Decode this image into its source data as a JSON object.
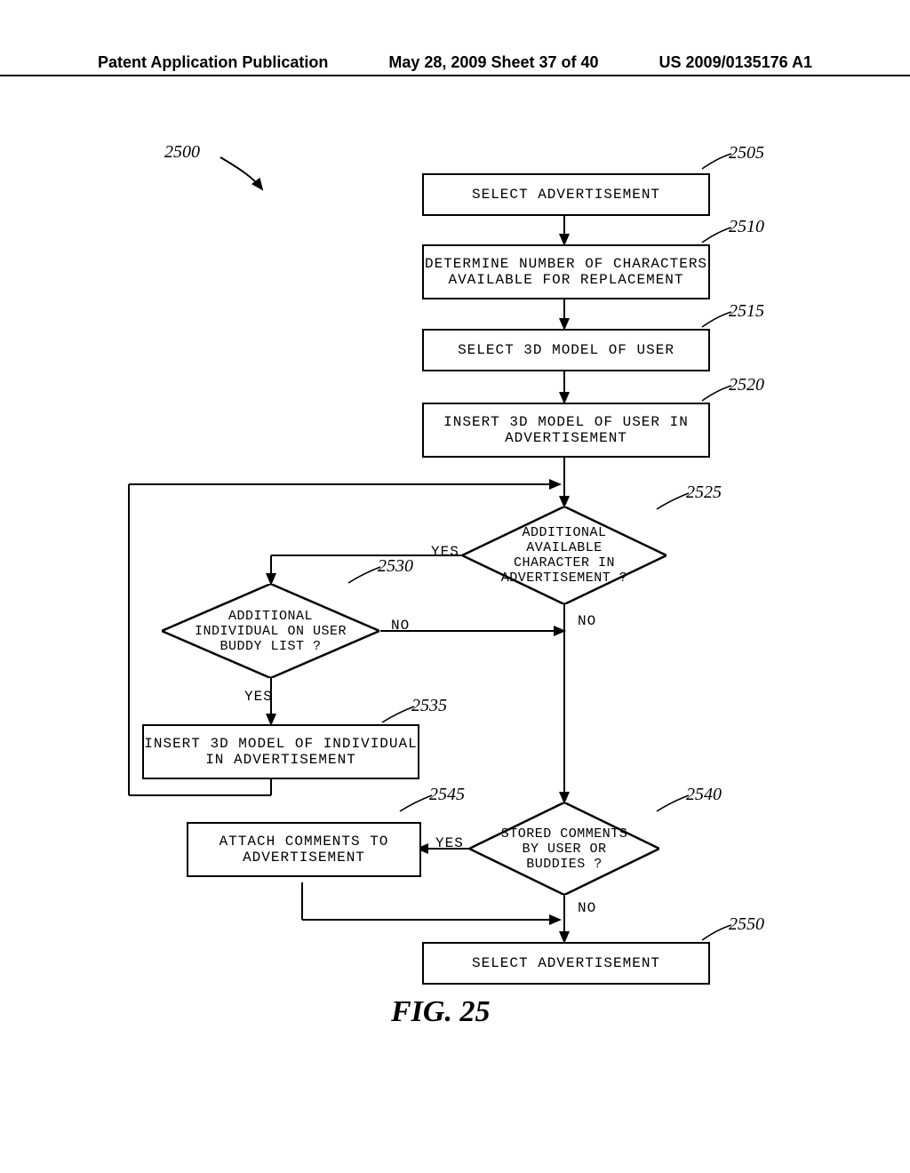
{
  "header": {
    "left": "Patent Application Publication",
    "center": "May 28, 2009  Sheet 37 of 40",
    "right": "US 2009/0135176 A1"
  },
  "refs": {
    "r2500": "2500",
    "r2505": "2505",
    "r2510": "2510",
    "r2515": "2515",
    "r2520": "2520",
    "r2525": "2525",
    "r2530": "2530",
    "r2535": "2535",
    "r2540": "2540",
    "r2545": "2545",
    "r2550": "2550"
  },
  "boxes": {
    "b2505": "SELECT ADVERTISEMENT",
    "b2510": "DETERMINE NUMBER OF CHARACTERS AVAILABLE FOR REPLACEMENT",
    "b2515": "SELECT 3D MODEL OF USER",
    "b2520": "INSERT 3D MODEL OF USER IN ADVERTISEMENT",
    "b2535": "INSERT 3D MODEL OF INDIVIDUAL IN ADVERTISEMENT",
    "b2545": "ATTACH COMMENTS TO ADVERTISEMENT",
    "b2550": "SELECT ADVERTISEMENT"
  },
  "diamonds": {
    "d2525": "ADDITIONAL AVAILABLE CHARACTER IN ADVERTISEMENT ?",
    "d2530": "ADDITIONAL INDIVIDUAL ON USER BUDDY LIST ?",
    "d2540": "STORED COMMENTS BY USER OR BUDDIES ?"
  },
  "labels": {
    "yes": "YES",
    "no": "NO"
  },
  "figure": "FIG. 25"
}
